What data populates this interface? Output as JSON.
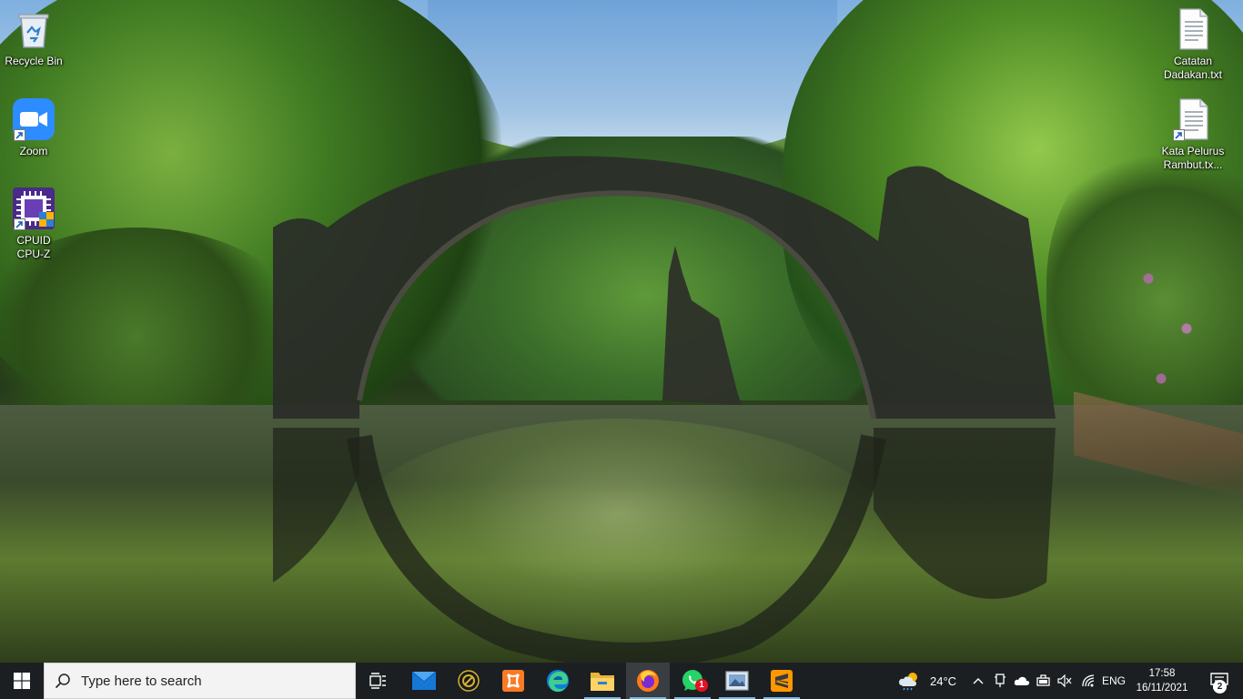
{
  "desktop": {
    "icons_left": [
      {
        "label": "Recycle Bin",
        "icon": "recycle-bin-icon"
      },
      {
        "label": "Zoom",
        "icon": "zoom-icon"
      },
      {
        "label": "CPUID\nCPU-Z",
        "line1": "CPUID",
        "line2": "CPU-Z",
        "icon": "cpu-z-icon"
      }
    ],
    "icons_right": [
      {
        "line1": "Catatan",
        "line2": "Dadakan.txt",
        "icon": "text-file-icon"
      },
      {
        "line1": "Kata Pelurus",
        "line2": "Rambut.tx...",
        "icon": "text-file-icon"
      }
    ]
  },
  "taskbar": {
    "search_placeholder": "Type here to search",
    "apps": [
      {
        "name": "task-view",
        "icon": "task-view-icon"
      },
      {
        "name": "mail",
        "icon": "mail-icon"
      },
      {
        "name": "app-circle",
        "icon": "circle-app-icon"
      },
      {
        "name": "xampp",
        "icon": "xampp-icon"
      },
      {
        "name": "edge",
        "icon": "edge-icon"
      },
      {
        "name": "file-explorer",
        "icon": "folder-icon"
      },
      {
        "name": "firefox",
        "icon": "firefox-icon",
        "active": true
      },
      {
        "name": "whatsapp",
        "icon": "whatsapp-icon",
        "badge": "1"
      },
      {
        "name": "photos",
        "icon": "photos-icon"
      },
      {
        "name": "sublime-text",
        "icon": "sublime-icon"
      }
    ],
    "weather": {
      "temp": "24°C",
      "icon": "weather-rain-icon"
    },
    "language": "ENG",
    "time": "17:58",
    "date": "16/11/2021",
    "notifications_count": "2"
  },
  "colors": {
    "taskbar_bg": "#1c1f22",
    "active_app": "#3a3d41",
    "accent": "#76b9ed",
    "badge_red": "#e81123"
  }
}
